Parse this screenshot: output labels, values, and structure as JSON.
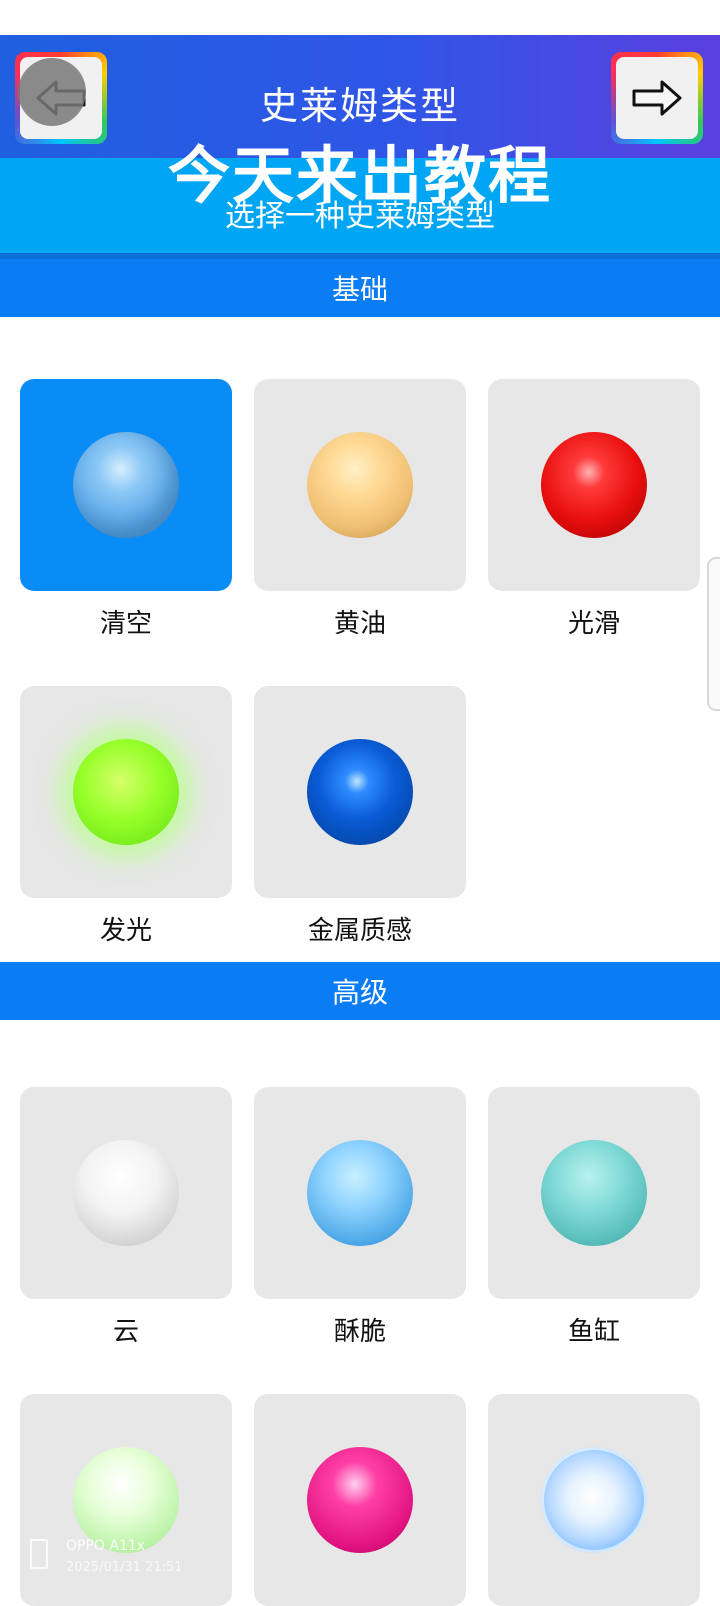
{
  "header": {
    "line1": "史莱姆类型",
    "line2": "今天来出教程",
    "line3": "选择一种史莱姆类型",
    "back_icon": "back-arrow-icon",
    "next_icon": "forward-arrow-icon"
  },
  "sections": {
    "basic": "基础",
    "advanced": "高级"
  },
  "basic_items": [
    {
      "label": "清空",
      "selected": true
    },
    {
      "label": "黄油",
      "selected": false
    },
    {
      "label": "光滑",
      "selected": false
    },
    {
      "label": "发光",
      "selected": false
    },
    {
      "label": "金属质感",
      "selected": false
    }
  ],
  "advanced_items": [
    {
      "label": "云"
    },
    {
      "label": "酥脆"
    },
    {
      "label": "鱼缸"
    },
    {
      "label": ""
    },
    {
      "label": ""
    },
    {
      "label": ""
    }
  ],
  "watermark": {
    "device": "OPPO A11x",
    "datetime": "2025/01/31 21:51"
  },
  "colors": {
    "accent": "#0a7cf4",
    "header_top": "#2f56e6",
    "header_band": "#00a5f3",
    "tile": "#e6e7e6",
    "selected_tile": "#0a8cf7"
  }
}
